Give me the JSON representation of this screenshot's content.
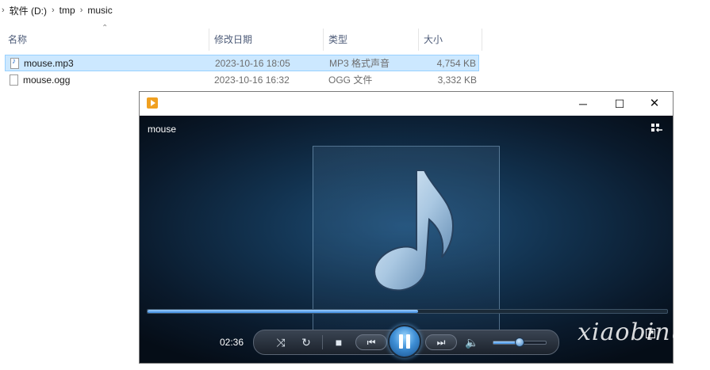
{
  "breadcrumb": {
    "items": [
      "软件 (D:)",
      "tmp",
      "music"
    ]
  },
  "columns": {
    "name": "名称",
    "date": "修改日期",
    "type": "类型",
    "size": "大小"
  },
  "files": [
    {
      "name": "mouse.mp3",
      "date": "2023-10-16 18:05",
      "type": "MP3 格式声音",
      "size": "4,754 KB",
      "icon": "audio-file-icon",
      "selected": true
    },
    {
      "name": "mouse.ogg",
      "date": "2023-10-16 16:32",
      "type": "OGG 文件",
      "size": "3,332 KB",
      "icon": "file-icon",
      "selected": false
    }
  ],
  "player": {
    "media_title": "mouse",
    "current_time": "02:36",
    "progress": 0.52,
    "volume": 0.5,
    "playing": true,
    "accent_color": "#3d8be0",
    "window_controls": {
      "minimize": "─",
      "maximize": "☐",
      "close": "✕"
    }
  },
  "watermark": "xiaobinqt"
}
